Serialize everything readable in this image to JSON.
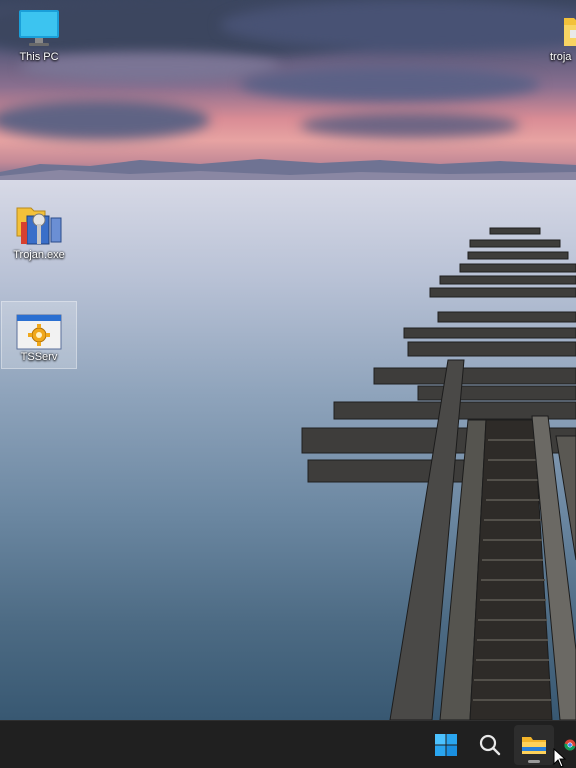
{
  "desktop": {
    "icons": [
      {
        "label": "This PC",
        "icon": "monitor-icon"
      },
      {
        "label": "troja",
        "icon": "folder-icon"
      },
      {
        "label": "Trojan.exe",
        "icon": "control-panel-folder-icon"
      },
      {
        "label": "TSServ",
        "icon": "gear-window-icon"
      }
    ],
    "selected_icon": "TSServ"
  },
  "taskbar": {
    "items": [
      {
        "name": "Start",
        "icon": "windows-start-icon"
      },
      {
        "name": "Search",
        "icon": "search-icon"
      },
      {
        "name": "File Explorer",
        "icon": "file-explorer-icon",
        "active": true
      },
      {
        "name": "Chrome",
        "icon": "chrome-icon"
      }
    ],
    "accent_color": "#0078d4",
    "background_color": "#202020"
  }
}
